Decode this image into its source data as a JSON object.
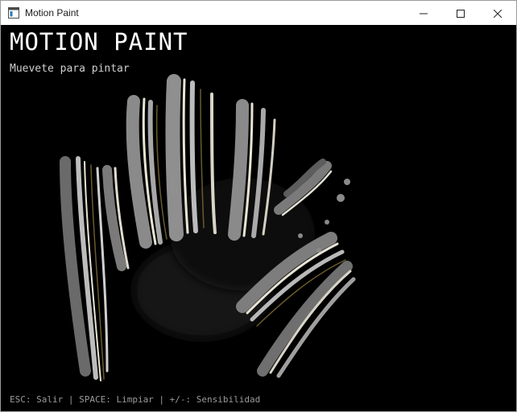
{
  "window": {
    "title": "Motion Paint",
    "app_icon": "app-window-icon",
    "controls": {
      "minimize_icon": "minimize-icon",
      "maximize_icon": "maximize-icon",
      "close_icon": "close-icon"
    }
  },
  "canvas": {
    "title": "MOTION PAINT",
    "subtitle": "Muevete para pintar",
    "hint": "ESC: Salir | SPACE: Limpiar | +/-: Sensibilidad",
    "colors": {
      "background": "#000000",
      "stroke_light": "#e8e4d4",
      "stroke_gray": "#8a8a8a",
      "stroke_dark": "#3a3a3a",
      "stroke_accent": "#6b5a2c"
    }
  }
}
